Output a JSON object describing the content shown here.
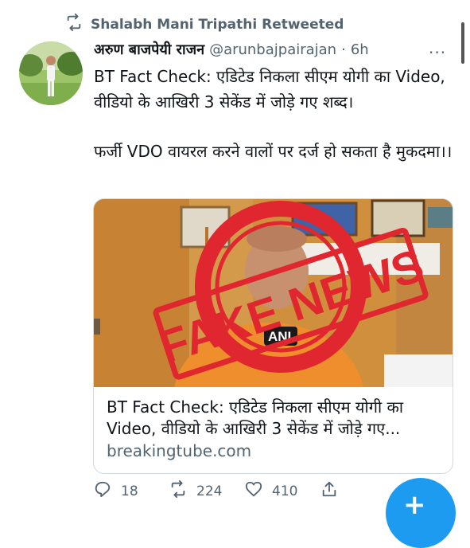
{
  "retweet_banner": {
    "text": "Shalabh Mani Tripathi Retweeted"
  },
  "tweet": {
    "author_name": "अरुण बाजपेयी राजन",
    "handle": "@arunbajpairajan",
    "separator": "·",
    "time": "6h",
    "more_label": "···",
    "paragraphs": [
      "BT Fact Check: एडिटेड निकला सीएम योगी का Video, वीडियो के आखिरी 3 सेकेंड में जोड़े गए शब्द।",
      "फर्जी VDO वायरल करने वालों पर दर्ज हो सकता है मुकदमा।।"
    ]
  },
  "link_card": {
    "stamp_text": "FAKE NEWS",
    "mic_logo": "ANI",
    "title": "BT Fact Check: एडिटेड निकला सीएम योगी का Video, वीडियो के आखिरी 3 सेकेंड में जोड़े गए...",
    "domain": "breakingtube.com"
  },
  "actions": {
    "replies": "18",
    "retweets": "224",
    "likes": "410"
  },
  "fab": {
    "label": "+"
  },
  "colors": {
    "accent": "#1d9bf0",
    "muted": "#536471",
    "stamp_red": "#e0262e"
  }
}
